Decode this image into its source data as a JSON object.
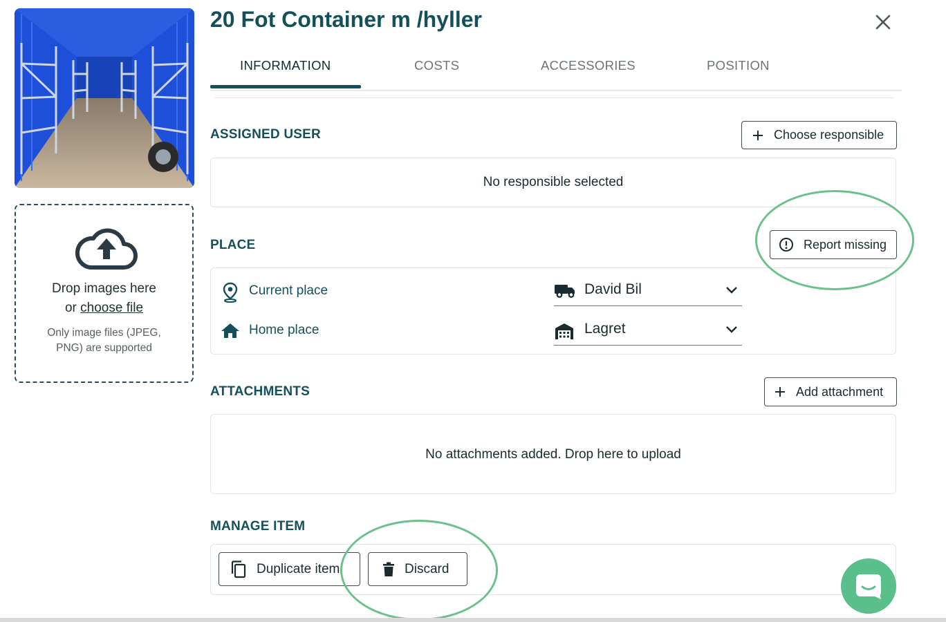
{
  "header": {
    "title": "20 Fot Container m /hyller",
    "close_icon": "close-icon"
  },
  "tabs": [
    {
      "label": "INFORMATION",
      "active": true
    },
    {
      "label": "COSTS",
      "active": false
    },
    {
      "label": "ACCESSORIES",
      "active": false
    },
    {
      "label": "POSITION",
      "active": false
    }
  ],
  "dropzone": {
    "line1": "Drop images here",
    "line2_prefix": "or ",
    "line2_link": "choose file",
    "note": "Only image files (JPEG, PNG) are supported",
    "icon": "cloud-upload-icon"
  },
  "assigned_user": {
    "label": "ASSIGNED USER",
    "button": "Choose responsible",
    "empty_text": "No responsible selected"
  },
  "place": {
    "label": "PLACE",
    "report_button": "Report missing",
    "current_label": "Current place",
    "current_value": "David Bil",
    "current_value_icon": "truck-icon",
    "home_label": "Home place",
    "home_value": "Lagret",
    "home_value_icon": "warehouse-icon"
  },
  "attachments": {
    "label": "ATTACHMENTS",
    "button": "Add attachment",
    "empty_text": "No attachments added. Drop here to upload"
  },
  "manage": {
    "label": "MANAGE ITEM",
    "duplicate_button": "Duplicate item",
    "discard_button": "Discard"
  },
  "colors": {
    "brand": "#14505a",
    "annotation": "#6cc18a",
    "chat": "#5abf8a"
  }
}
